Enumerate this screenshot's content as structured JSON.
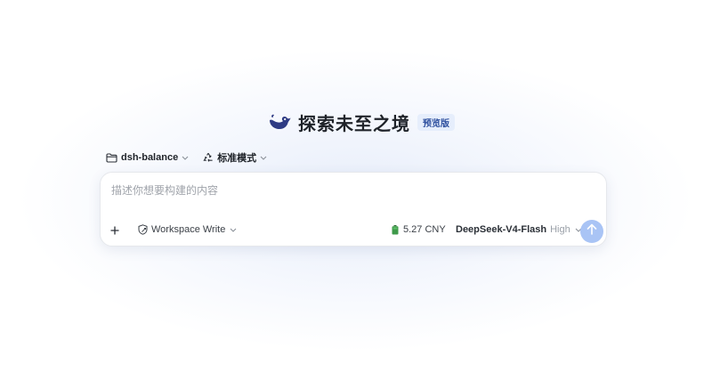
{
  "brand": {
    "title": "探索未至之境",
    "badge": "预览版",
    "logo_icon": "whale-logo-icon"
  },
  "selectors": {
    "workspace": {
      "label": "dsh-balance",
      "icon": "folder-icon"
    },
    "mode": {
      "label": "标准模式",
      "icon": "recycle-icon"
    }
  },
  "composer": {
    "placeholder": "描述你想要构建的内容",
    "value": "",
    "add_icon": "plus-icon",
    "permission": {
      "label": "Workspace Write",
      "icon": "shield-icon"
    },
    "balance": {
      "amount": "5.27 CNY",
      "icon": "battery-icon"
    },
    "model": {
      "name": "DeepSeek-V4-Flash",
      "effort": "High"
    },
    "send_icon": "arrow-up-icon"
  },
  "colors": {
    "accent": "#a9c4f5",
    "brand": "#3b4fa3",
    "badge_bg": "#e6eefc",
    "badge_text": "#2d4f9e",
    "battery": "#3f9a4a"
  }
}
